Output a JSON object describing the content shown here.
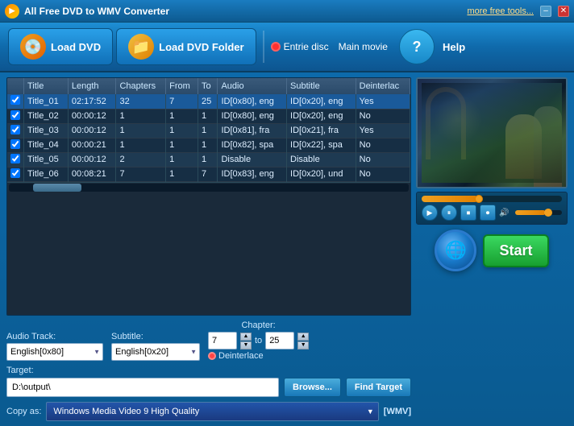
{
  "app": {
    "title": "All Free DVD to WMV Converter",
    "more_tools": "more free tools...",
    "min_btn": "–",
    "close_btn": "✕"
  },
  "toolbar": {
    "load_dvd": "Load DVD",
    "load_folder": "Load DVD Folder",
    "entire_disc": "Entrie disc",
    "main_movie": "Main movie",
    "help": "Help"
  },
  "table": {
    "headers": [
      "",
      "Title",
      "Length",
      "Chapters",
      "From",
      "To",
      "Audio",
      "Subtitle",
      "Deinterlac"
    ],
    "rows": [
      {
        "checked": true,
        "title": "Title_01",
        "length": "02:17:52",
        "chapters": "32",
        "from": "7",
        "to": "25",
        "audio": "ID[0x80], eng",
        "subtitle": "ID[0x20], eng",
        "deinterlace": "Yes",
        "selected": true
      },
      {
        "checked": true,
        "title": "Title_02",
        "length": "00:00:12",
        "chapters": "1",
        "from": "1",
        "to": "1",
        "audio": "ID[0x80], eng",
        "subtitle": "ID[0x20], eng",
        "deinterlace": "No",
        "selected": false
      },
      {
        "checked": true,
        "title": "Title_03",
        "length": "00:00:12",
        "chapters": "1",
        "from": "1",
        "to": "1",
        "audio": "ID[0x81], fra",
        "subtitle": "ID[0x21], fra",
        "deinterlace": "Yes",
        "selected": false
      },
      {
        "checked": true,
        "title": "Title_04",
        "length": "00:00:21",
        "chapters": "1",
        "from": "1",
        "to": "1",
        "audio": "ID[0x82], spa",
        "subtitle": "ID[0x22], spa",
        "deinterlace": "No",
        "selected": false
      },
      {
        "checked": true,
        "title": "Title_05",
        "length": "00:00:12",
        "chapters": "2",
        "from": "1",
        "to": "1",
        "audio": "Disable",
        "subtitle": "Disable",
        "deinterlace": "No",
        "selected": false
      },
      {
        "checked": true,
        "title": "Title_06",
        "length": "00:08:21",
        "chapters": "7",
        "from": "1",
        "to": "7",
        "audio": "ID[0x83], eng",
        "subtitle": "ID[0x20], und",
        "deinterlace": "No",
        "selected": false
      }
    ]
  },
  "controls": {
    "audio_track_label": "Audio Track:",
    "audio_track_value": "English[0x80]",
    "subtitle_label": "Subtitle:",
    "subtitle_value": "English[0x20]",
    "chapter_label": "Chapter:",
    "chapter_from": "7",
    "chapter_to_label": "to",
    "chapter_to": "25",
    "deinterlace_label": "Deinterlace"
  },
  "target": {
    "label": "Target:",
    "path": "D:\\output\\",
    "browse_btn": "Browse...",
    "find_btn": "Find Target",
    "copy_label": "Copy as:",
    "copy_format": "Windows Media Video 9 High Quality",
    "format_tag": "[WMV]"
  },
  "start": {
    "label": "Start"
  },
  "player": {
    "progress": 40,
    "volume": 65
  }
}
